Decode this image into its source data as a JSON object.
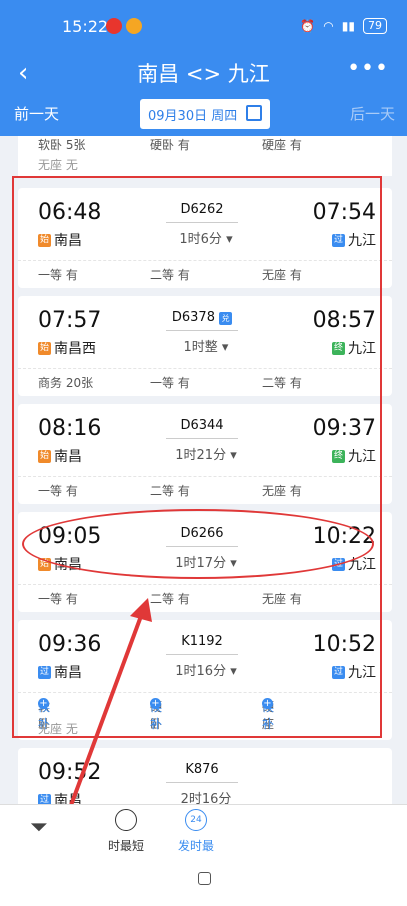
{
  "status_bar": {
    "time": "15:22",
    "battery": "79"
  },
  "nav": {
    "title": "南昌 <> 九江",
    "back_icon": "chevron-left-icon",
    "more_label": "•••"
  },
  "date_bar": {
    "prev_label": "前一天",
    "date_label": "09月30日 周四",
    "next_label": "后一天"
  },
  "partial_top": {
    "seat1": "软卧 5张",
    "seat2": "硬卧 有",
    "seat3": "硬座 有",
    "seat4": "无座 无"
  },
  "trains": [
    {
      "dep": "06:48",
      "train_no": "D6262",
      "dur": "1时6分",
      "arr": "07:54",
      "from_tag": "始",
      "from": "南昌",
      "to_tag": "过",
      "to": "九江",
      "seat1": "一等 有",
      "seat2": "二等 有",
      "seat3": "无座 有"
    },
    {
      "dep": "07:57",
      "train_no": "D6378",
      "dur": "1时整",
      "arr": "08:57",
      "from_tag": "始",
      "from": "南昌西",
      "to_tag": "终",
      "to": "九江",
      "badge": "兑",
      "seat1": "商务 20张",
      "seat2": "一等 有",
      "seat3": "二等 有"
    },
    {
      "dep": "08:16",
      "train_no": "D6344",
      "dur": "1时21分",
      "arr": "09:37",
      "from_tag": "始",
      "from": "南昌",
      "to_tag": "终",
      "to": "九江",
      "seat1": "一等 有",
      "seat2": "二等 有",
      "seat3": "无座 有"
    },
    {
      "dep": "09:05",
      "train_no": "D6266",
      "dur": "1时17分",
      "arr": "10:22",
      "from_tag": "始",
      "from": "南昌",
      "to_tag": "过",
      "to": "九江",
      "seat1": "一等 有",
      "seat2": "二等 有",
      "seat3": "无座 有"
    },
    {
      "dep": "09:36",
      "train_no": "K1192",
      "dur": "1时16分",
      "arr": "10:52",
      "from_tag": "过",
      "from": "南昌",
      "to_tag": "过",
      "to": "九江",
      "seat1": "软卧",
      "seat2": "硬卧",
      "seat3": "硬座",
      "candidate": "候补",
      "seat4": "无座 无"
    },
    {
      "dep": "09:52",
      "train_no": "K876",
      "dur": "2时16分",
      "from_tag": "过",
      "from": "南昌"
    }
  ],
  "bottom_tabs": {
    "tab1": "时最短",
    "tab2": "发时最",
    "tab2_icon_num": "24"
  },
  "colors": {
    "primary": "#3a8cf0",
    "annotation": "#e03838"
  }
}
